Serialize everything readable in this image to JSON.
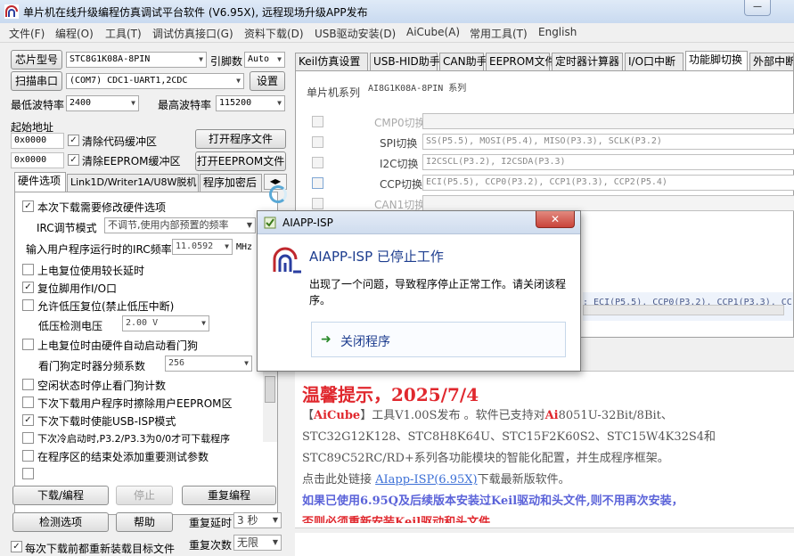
{
  "window": {
    "title": "单片机在线升级编程仿真调试平台软件 (V6.95X), 远程现场升级APP发布",
    "minimize_label": "—"
  },
  "menu": [
    "文件(F)",
    "编程(O)",
    "工具(T)",
    "调试仿真接口(G)",
    "资料下载(D)",
    "USB驱动安装(D)",
    "AiCube(A)",
    "常用工具(T)",
    "English"
  ],
  "left": {
    "chip_model_btn": "芯片型号",
    "chip_model_value": "STC8G1K08A-8PIN",
    "pin_count_label": "引脚数",
    "pin_count_value": "Auto",
    "scan_port_btn": "扫描串口",
    "port_value": "(COM7) CDC1-UART1,2CDC",
    "settings_btn": "设置",
    "min_baud_label": "最低波特率",
    "min_baud_value": "2400",
    "max_baud_label": "最高波特率",
    "max_baud_value": "115200",
    "start_addr_label": "起始地址",
    "addr1_value": "0x0000",
    "clear_code_label": "清除代码缓冲区",
    "open_prog_btn": "打开程序文件",
    "addr2_value": "0x0000",
    "clear_eeprom_label": "清除EEPROM缓冲区",
    "open_eeprom_btn": "打开EEPROM文件",
    "tabs": [
      "硬件选项",
      "Link1D/Writer1A/U8W脱机",
      "程序加密后"
    ],
    "options": {
      "modify_hw": "本次下载需要修改硬件选项",
      "irc_mode_label": "IRC调节模式",
      "irc_mode_value": "不调节,使用内部预置的频率",
      "irc_freq_label": "输入用户程序运行时的IRC频率",
      "irc_freq_value": "11.0592",
      "irc_freq_unit": "MHz",
      "long_delay": "上电复位使用较长延时",
      "reset_pin": "复位脚用作I/O口",
      "lvr": "允许低压复位(禁止低压中断)",
      "lvd_label": "低压检测电压",
      "lvd_value": "2.00 V",
      "wdt_auto": "上电复位时由硬件自动启动看门狗",
      "wdt_div_label": "看门狗定时器分频系数",
      "wdt_div_value": "256",
      "idle_wdt": "空闲状态时停止看门狗计数",
      "erase_eeprom": "下次下载用户程序时擦除用户EEPROM区",
      "usb_isp": "下次下载时使能USB-ISP模式",
      "cold_start": "下次冷启动时,P3.2/P3.3为0/0才可下载程序",
      "add_params": "在程序区的结束处添加重要测试参数"
    },
    "download_btn": "下载/编程",
    "stop_btn": "停止",
    "reprogram_btn": "重复编程",
    "detect_btn": "检测选项",
    "help_btn": "帮助",
    "repeat_delay_label": "重复延时",
    "repeat_delay_value": "3 秒",
    "repeat_count_label": "重复次数",
    "repeat_count_value": "无限",
    "reload_label": "每次下载前都重新装载目标文件"
  },
  "right": {
    "tabs": [
      "Keil仿真设置",
      "USB-HID助手",
      "CAN助手",
      "EEPROM文件",
      "定时器计算器",
      "I/O口中断",
      "功能脚切换",
      "外部中断"
    ],
    "mcu_series_label": "单片机系列",
    "mcu_series_value": "AI8G1K08A-8PIN 系列",
    "switch_rows": [
      {
        "label": "CMP0切换",
        "value": ""
      },
      {
        "label": "SPI切换",
        "value": "SS(P5.5), MOSI(P5.4), MISO(P3.3), SCLK(P3.2)"
      },
      {
        "label": "I2C切换",
        "value": "I2CSCL(P3.2), I2CSDA(P3.3)"
      },
      {
        "label": "CCP切换",
        "value": "ECI(P5.5), CCP0(P3.2), CCP1(P3.3), CCP2(P5.4)"
      },
      {
        "label": "CAN1切换",
        "value": ""
      }
    ],
    "partial_line": ": ECI(P5.5), CCP0(P3.2), CCP1(P3.3), CC",
    "notice": {
      "title": "温馨提示，2025/7/4",
      "line1_a": "【",
      "line1_b": "AiCube",
      "line1_c": "】工具V1.00S发布 。软件已支持对",
      "line1_d": "Ai",
      "line1_e": "8051U-32Bit/8Bit、",
      "line2": "STC32G12K128、STC8H8K64U、STC15F2K60S2、STC15W4K32S4和",
      "line3": "STC89C52RC/RD+系列各功能模块的智能化配置，并生成程序框架。",
      "line4_a": "点击此处链接 ",
      "line4_b": "AIapp-ISP(6.95X)",
      "line4_c": "下载最新版软件。",
      "line5": "如果已使用6.95Q及后续版本安装过Keil驱动和头文件,则不用再次安装，",
      "line6": "否则必须重新安装Keil驱动和头文件"
    }
  },
  "dialog": {
    "title": "AIAPP-ISP",
    "heading": "AIAPP-ISP 已停止工作",
    "message": "出现了一个问题，导致程序停止正常工作。请关闭该程序。",
    "close_label": "关闭程序",
    "close_x": "✕"
  },
  "colors": {
    "notice_red": "#e0282e",
    "link_blue": "#3b6fd6",
    "dialog_heading": "#1d3d8f",
    "close_button_red": "#c9433a"
  }
}
